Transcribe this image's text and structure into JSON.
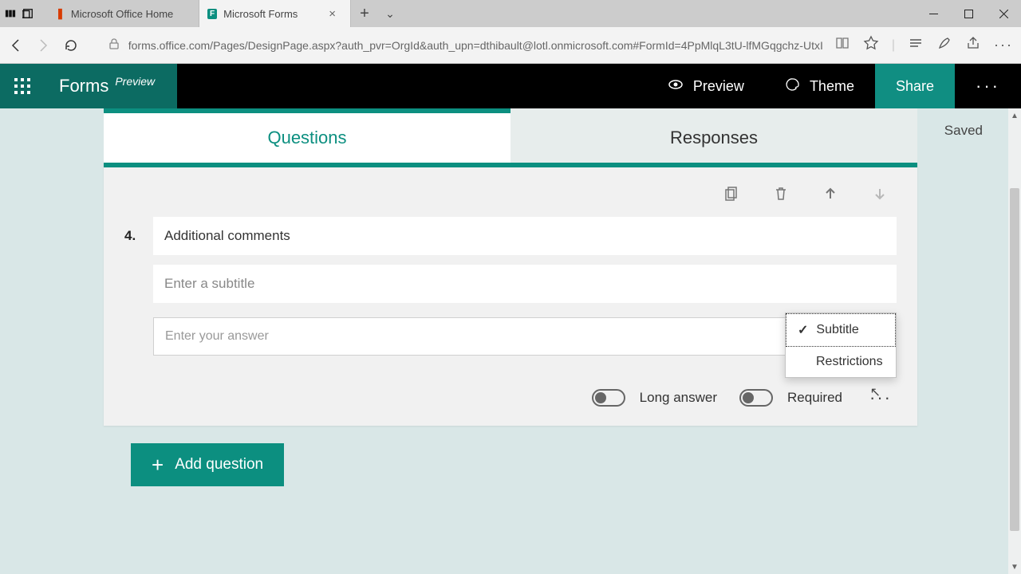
{
  "browser": {
    "tabs": [
      {
        "label": "Microsoft Office Home"
      },
      {
        "label": "Microsoft Forms"
      }
    ],
    "url": "forms.office.com/Pages/DesignPage.aspx?auth_pvr=OrgId&auth_upn=dthibault@lotl.onmicrosoft.com#FormId=4PpMlqL3tU-lfMGqgchz-UtxI"
  },
  "header": {
    "brand": "Forms",
    "brand_sub": "Preview",
    "preview": "Preview",
    "theme": "Theme",
    "share": "Share"
  },
  "status": {
    "saved": "Saved"
  },
  "tabs": {
    "questions": "Questions",
    "responses": "Responses"
  },
  "question": {
    "number": "4.",
    "title": "Additional comments",
    "subtitle_placeholder": "Enter a subtitle",
    "answer_placeholder": "Enter your answer",
    "long_answer_label": "Long answer",
    "required_label": "Required"
  },
  "dropdown": {
    "subtitle": "Subtitle",
    "restrictions": "Restrictions"
  },
  "add_question": "Add question"
}
